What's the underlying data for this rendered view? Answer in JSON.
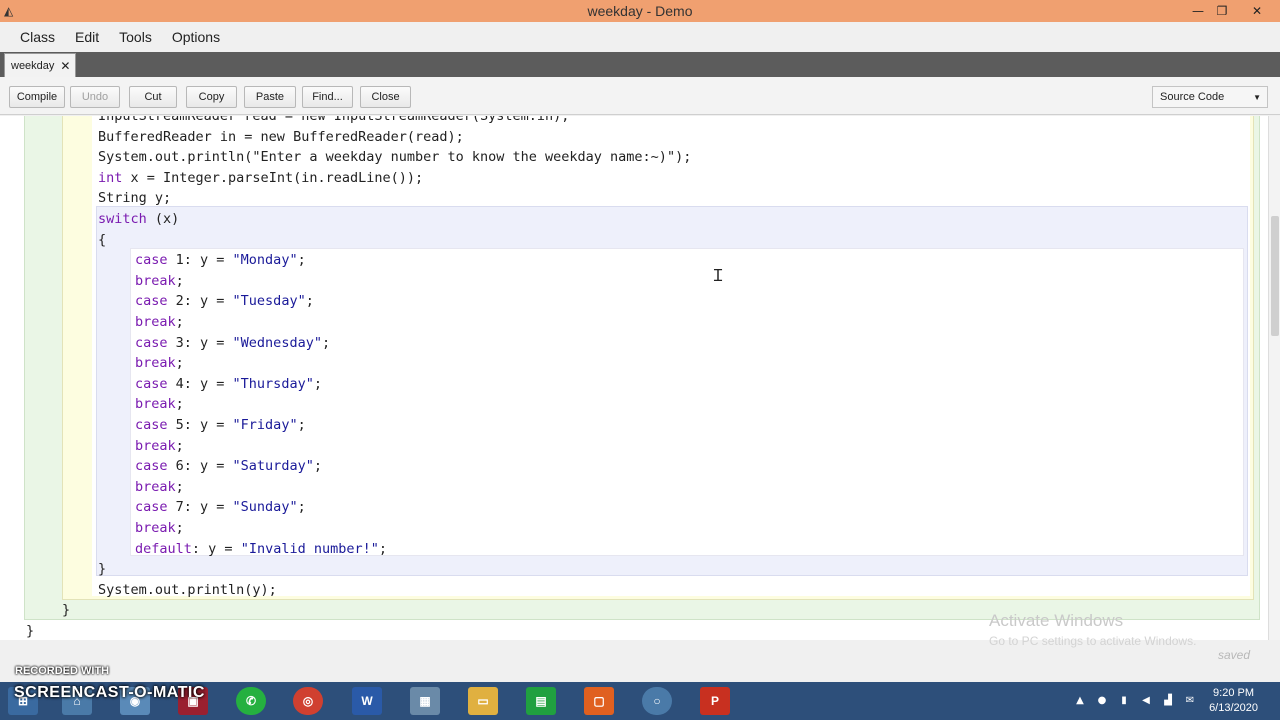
{
  "window": {
    "title": "weekday - Demo"
  },
  "menu": [
    "Class",
    "Edit",
    "Tools",
    "Options"
  ],
  "tab": {
    "label": "weekday",
    "close": "✕"
  },
  "toolbar": {
    "compile": "Compile",
    "undo": "Undo",
    "cut": "Cut",
    "copy": "Copy",
    "paste": "Paste",
    "find": "Find...",
    "close": "Close",
    "view": "Source Code"
  },
  "code": [
    {
      "text": "InputStreamReader read = new InputStreamReader(System.in);"
    },
    {
      "text": "BufferedReader in = new BufferedReader(read);"
    },
    {
      "text": "System.out.println(\"Enter a weekday number to know the weekday name:~)\");"
    },
    {
      "kw": "int",
      "text": " x = Integer.parseInt(in.readLine());"
    },
    {
      "text": "String y;"
    },
    {
      "kw": "switch",
      "text": " (x)"
    },
    {
      "text": "{"
    },
    {
      "kw": "case",
      "text": " 1: y = ",
      "str": "\"Monday\"",
      "tail": ";"
    },
    {
      "kw": "break",
      "text": ";"
    },
    {
      "kw": "case",
      "text": " 2: y = ",
      "str": "\"Tuesday\"",
      "tail": ";"
    },
    {
      "kw": "break",
      "text": ";"
    },
    {
      "kw": "case",
      "text": " 3: y = ",
      "str": "\"Wednesday\"",
      "tail": ";"
    },
    {
      "kw": "break",
      "text": ";"
    },
    {
      "kw": "case",
      "text": " 4: y = ",
      "str": "\"Thursday\"",
      "tail": ";"
    },
    {
      "kw": "break",
      "text": ";"
    },
    {
      "kw": "case",
      "text": " 5: y = ",
      "str": "\"Friday\"",
      "tail": ";"
    },
    {
      "kw": "break",
      "text": ";"
    },
    {
      "kw": "case",
      "text": " 6: y = ",
      "str": "\"Saturday\"",
      "tail": ";"
    },
    {
      "kw": "break",
      "text": ";"
    },
    {
      "kw": "case",
      "text": " 7: y = ",
      "str": "\"Sunday\"",
      "tail": ";"
    },
    {
      "kw": "break",
      "text": ";"
    },
    {
      "kw": "default",
      "text": ": y = ",
      "str": "\"Invalid number!\"",
      "tail": ";"
    },
    {
      "text": "}"
    },
    {
      "text": "System.out.println(y);"
    },
    {
      "text": "}"
    },
    {
      "text": "}"
    }
  ],
  "status": {
    "saved": "saved"
  },
  "watermark": {
    "line1": "Activate Windows",
    "line2": "Go to PC settings to activate Windows."
  },
  "recorder": {
    "line1": "RECORDED WITH",
    "line2": "SCREENCAST-O-MATIC"
  },
  "taskbar": {
    "time": "9:20 PM",
    "date": "6/13/2020"
  },
  "icons": {
    "app": "bluej-icon",
    "minimize": "minimize-icon",
    "maximize": "restore-icon",
    "close": "close-icon",
    "dropdown": "chevron-down-icon"
  },
  "colors": {
    "titlebar": "#f0a070",
    "tabstrip": "#5c5c5c",
    "keyword": "#7a1bb0",
    "string": "#1a1a99",
    "taskbar": "#2d4f7a"
  }
}
